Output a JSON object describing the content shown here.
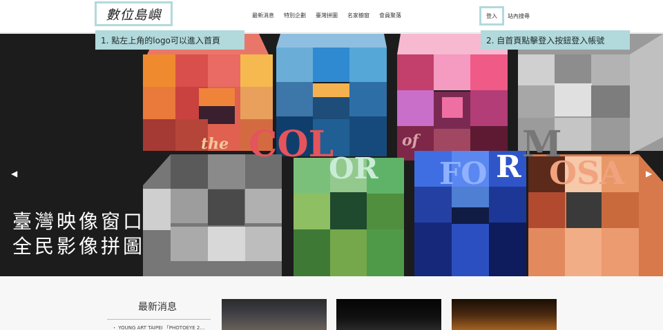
{
  "header": {
    "logo_text": "數位島嶼",
    "nav": [
      "最新消息",
      "特別企劃",
      "臺灣拼圖",
      "名家櫥窗",
      "會員聚落"
    ],
    "login_label": "登入",
    "search_label": "站內搜尋"
  },
  "callouts": {
    "step1": "1. 點左上角的logo可以進入首頁",
    "step2": "2. 自首頁點擊登入按鈕登入帳號"
  },
  "banner": {
    "title_line1": "臺灣映像窗口",
    "title_line2": "全民影像拼圖",
    "words": {
      "the": "the",
      "col": "COL",
      "of": "of",
      "m": "M",
      "or": "OR",
      "fo": "FO",
      "r": "R",
      "osa": "OSA"
    },
    "prev_icon": "chevron-left-icon",
    "next_icon": "chevron-right-icon"
  },
  "news": {
    "heading": "最新消息",
    "item1": "・ YOUNG ART TAIPEI 「PHOTOEYE 2…"
  },
  "colors": {
    "accent": "#b2d9dc",
    "banner_bg": "#1c1c1c"
  }
}
